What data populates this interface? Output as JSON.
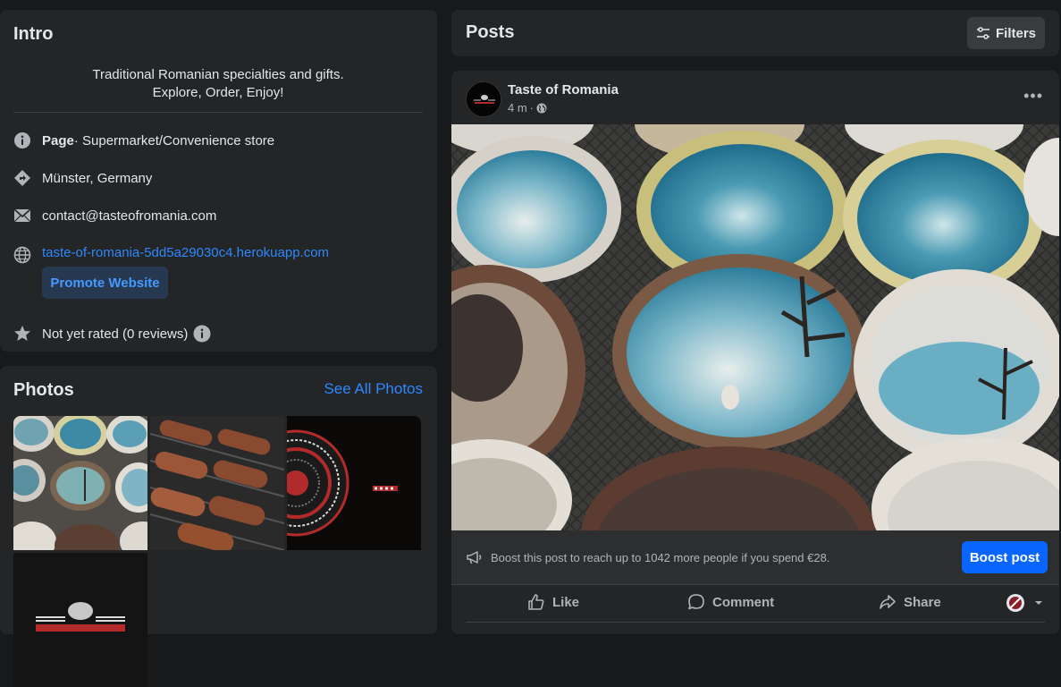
{
  "intro": {
    "title": "Intro",
    "description_line1": "Traditional Romanian specialties and gifts.",
    "description_line2": "Explore, Order, Enjoy!",
    "category_bold": "Page",
    "category_rest": " · Supermarket/Convenience store",
    "location": "Münster, Germany",
    "email": "contact@tasteofromania.com",
    "website": "taste-of-romania-5dd5a29030c4.herokuapp.com",
    "promote_label": "Promote Website",
    "rating": "Not yet rated (0 reviews)",
    "icons": [
      "info-icon",
      "location-icon",
      "mail-icon",
      "globe-icon",
      "star-icon"
    ]
  },
  "photos": {
    "title": "Photos",
    "see_all": "See All Photos"
  },
  "posts": {
    "title": "Posts",
    "filters_label": "Filters"
  },
  "post": {
    "author": "Taste of Romania",
    "time": "4 m",
    "boost_text": "Boost this post to reach up to 1042 more people if you spend €28.",
    "boost_button": "Boost post",
    "like": "Like",
    "comment": "Comment",
    "share": "Share"
  },
  "colors": {
    "background": "#18191a",
    "card": "#242526",
    "link": "#2d88ff",
    "primary_button": "#0866ff"
  }
}
